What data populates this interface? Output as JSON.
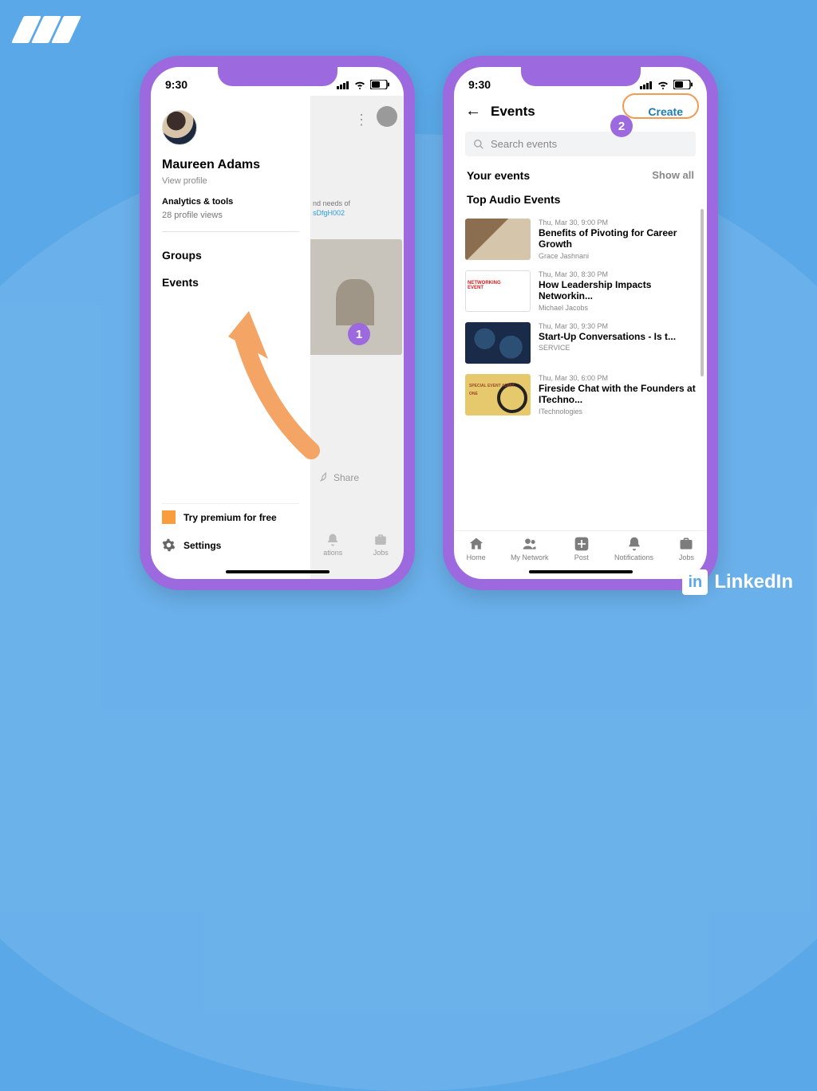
{
  "colors": {
    "phone_bezel": "#9c6ade",
    "accent_orange": "#f29b55",
    "accent_purple": "#9c6ade",
    "bg_blue": "#5aa8e8"
  },
  "brand": {
    "name": "LinkedIn",
    "short": "in"
  },
  "status": {
    "time": "9:30"
  },
  "p1": {
    "profile": {
      "name": "Maureen Adams",
      "view_profile": "View profile"
    },
    "analytics": {
      "title": "Analytics & tools",
      "views": "28 profile views"
    },
    "nav": {
      "groups": "Groups",
      "events": "Events"
    },
    "premium": "Try premium for free",
    "settings": "Settings",
    "bg": {
      "snippet_pre": "nd needs of",
      "snippet_code": "sDfgH002",
      "share": "Share",
      "tabs": {
        "notifications": "ations",
        "jobs": "Jobs"
      }
    }
  },
  "p2": {
    "title": "Events",
    "create": "Create",
    "search_placeholder": "Search events",
    "your_events": "Your events",
    "show_all": "Show all",
    "top_audio": "Top Audio Events",
    "events": [
      {
        "time": "Thu, Mar 30, 9:00 PM",
        "title": "Benefits of Pivoting for Career Growth",
        "author": "Grace Jashnani"
      },
      {
        "time": "Thu, Mar 30, 8:30 PM",
        "title": "How Leadership Impacts Networkin...",
        "author": "Michael Jacobs"
      },
      {
        "time": "Thu, Mar 30, 9:30 PM",
        "title": "Start-Up Conversations - Is t...",
        "author": "SERVICE"
      },
      {
        "time": "Thu, Mar 30, 6:00 PM",
        "title": "Fireside Chat with the Founders at ITechno...",
        "author": "ITechnologies"
      }
    ],
    "tabs": {
      "home": "Home",
      "network": "My Network",
      "post": "Post",
      "notifications": "Notifications",
      "jobs": "Jobs"
    }
  },
  "step_badge": {
    "one": "1",
    "two": "2"
  }
}
